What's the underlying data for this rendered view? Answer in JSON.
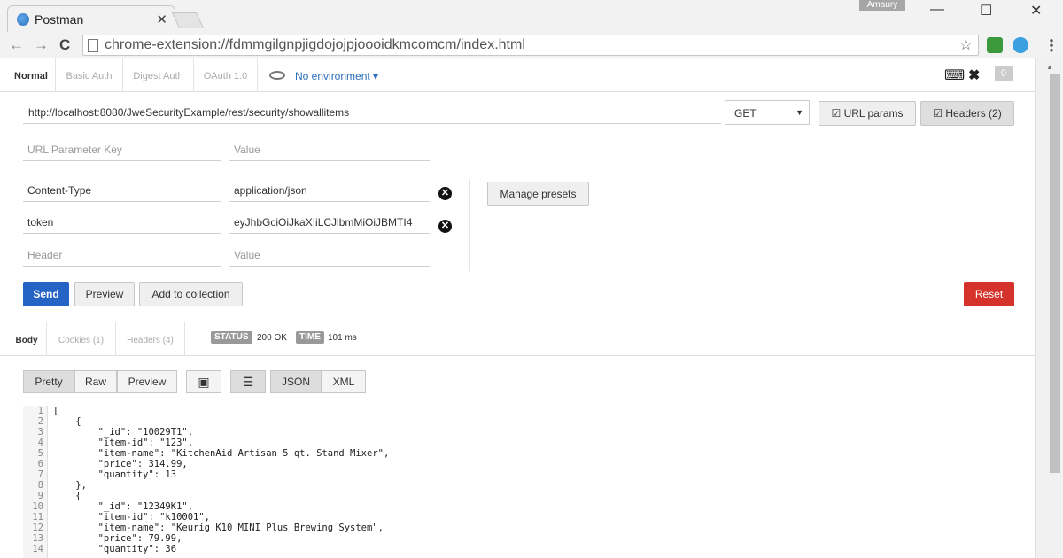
{
  "browser": {
    "tab_title": "Postman",
    "tab_close": "✕",
    "user": "Amaury",
    "url": "chrome-extension://fdmmgilgnpjigdojojpjoooidkmcomcm/index.html",
    "win_min": "—",
    "win_max": "☐",
    "win_close": "✕",
    "back": "←",
    "forward": "→",
    "reload": "C",
    "star": "☆"
  },
  "auth_tabs": [
    "Normal",
    "Basic Auth",
    "Digest Auth",
    "OAuth 1.0"
  ],
  "environment": "No environment ▾",
  "tools": {
    "keyboard": "⌨",
    "wrench": "✖",
    "count": "0"
  },
  "request": {
    "url": "http://localhost:8080/JweSecurityExample/rest/security/showallitems",
    "method": "GET",
    "method_caret": "▼",
    "url_params_label": "URL params",
    "headers_label": "Headers (2)",
    "param_key_placeholder": "URL Parameter Key",
    "param_value_placeholder": "Value",
    "headers": [
      {
        "key": "Content-Type",
        "value": "application/json"
      },
      {
        "key": "token",
        "value": "eyJhbGciOiJkaXIiLCJlbmMiOiJBMTI4"
      }
    ],
    "header_key_placeholder": "Header",
    "header_value_placeholder": "Value",
    "manage_presets": "Manage presets",
    "send": "Send",
    "preview": "Preview",
    "add_to_collection": "Add to collection",
    "reset": "Reset"
  },
  "response": {
    "tabs": [
      "Body",
      "Cookies (1)",
      "Headers (4)"
    ],
    "status_label": "STATUS",
    "status_value": "200 OK",
    "time_label": "TIME",
    "time_value": "101 ms",
    "view_modes": [
      "Pretty",
      "Raw",
      "Preview"
    ],
    "formats": [
      "JSON",
      "XML"
    ],
    "line_numbers": [
      "1",
      "2",
      "3",
      "4",
      "5",
      "6",
      "7",
      "8",
      "9",
      "10",
      "11",
      "12",
      "13",
      "14"
    ],
    "code_lines": [
      "[",
      "    {",
      "        \"_id\": \"10029T1\",",
      "        \"item-id\": \"123\",",
      "        \"item-name\": \"KitchenAid Artisan 5 qt. Stand Mixer\",",
      "        \"price\": 314.99,",
      "        \"quantity\": 13",
      "    },",
      "    {",
      "        \"_id\": \"12349K1\",",
      "        \"item-id\": \"k10001\",",
      "        \"item-name\": \"Keurig K10 MINI Plus Brewing System\",",
      "        \"price\": 79.99,",
      "        \"quantity\": 36"
    ]
  },
  "colors": {
    "accent": "#2563c4",
    "danger": "#d6322c",
    "link": "#2a6ebb"
  }
}
